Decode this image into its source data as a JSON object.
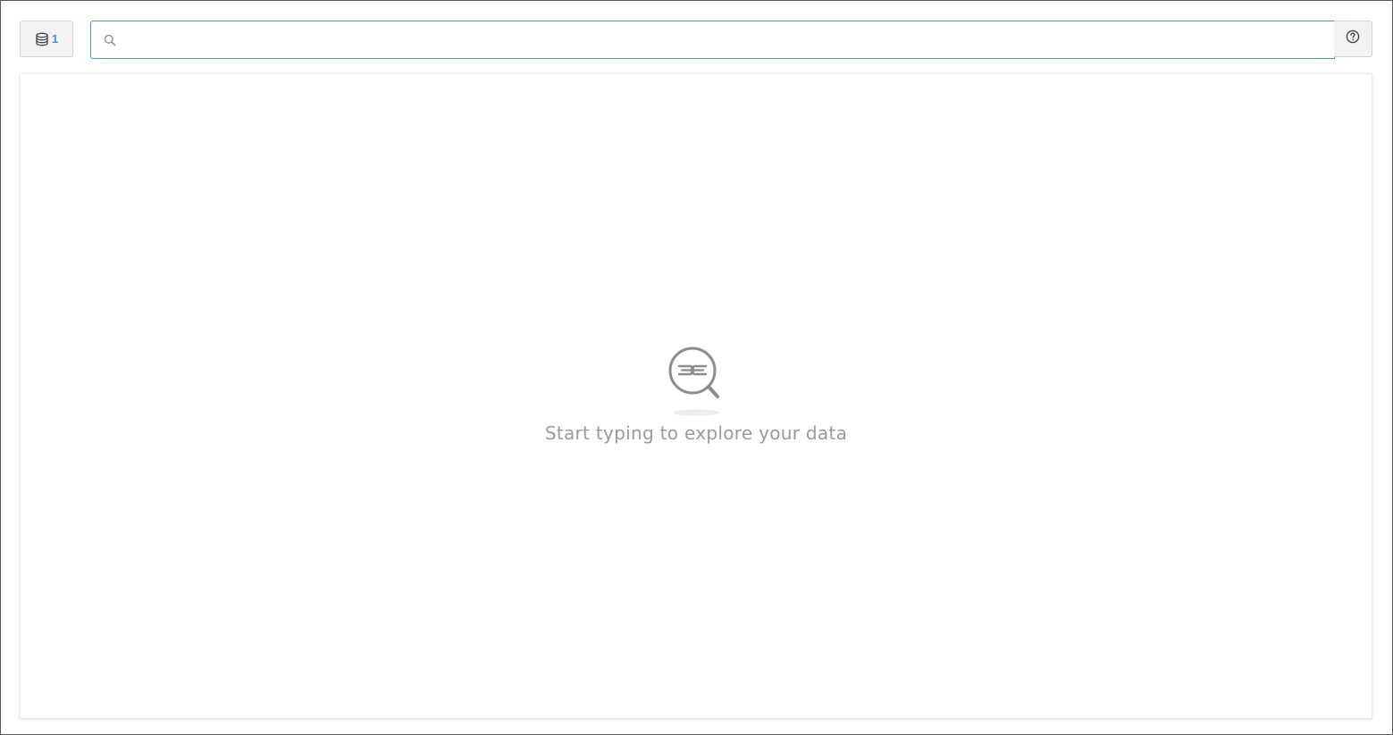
{
  "toolbar": {
    "datasource_count": "1",
    "search": {
      "value": "",
      "placeholder": ""
    }
  },
  "icons": {
    "datasource": "database-icon",
    "search": "search-icon",
    "help": "question-circle-icon",
    "empty_state": "search-logo-icon"
  },
  "empty_state": {
    "message": "Start typing to explore your data"
  },
  "colors": {
    "accent": "#3c8de6",
    "input_border": "#4a8fe0",
    "muted_text": "#9a9a9a",
    "button_bg": "#f3f3f3"
  }
}
